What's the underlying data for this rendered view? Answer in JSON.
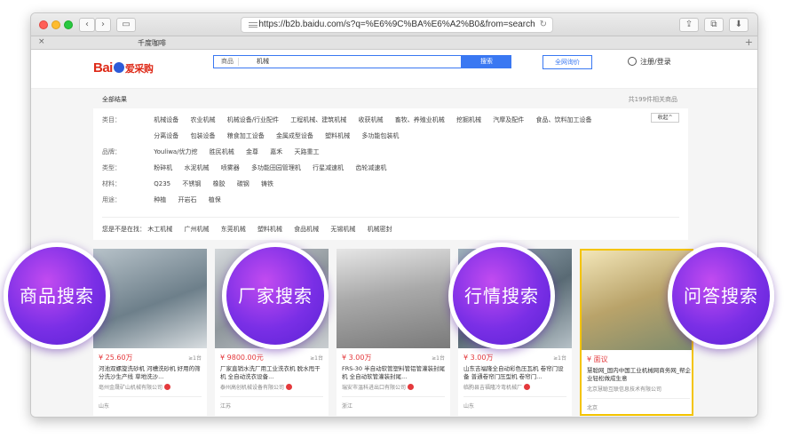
{
  "browser": {
    "url": "https://b2b.baidu.com/s?q=%E6%9C%BA%E6%A2%B0&from=search",
    "tab_title": "千度咖啡",
    "back_label": "‹",
    "forward_label": "›",
    "new_tab_label": "+",
    "close_tab_label": "×"
  },
  "header": {
    "logo_text": "Bai",
    "logo_sub": "爱采购",
    "search_category": "商品",
    "search_value": "机械",
    "search_button": "搜索",
    "compare_button": "全网询价",
    "user_link": "注册/登录"
  },
  "results": {
    "all_label": "全部结果",
    "count_text": "共199件相关商品"
  },
  "filters": {
    "collapse_label": "收起^",
    "rows": [
      {
        "label": "类目：",
        "options": [
          "机械设备",
          "农业机械",
          "机械设备/行业配件",
          "工程机械、建筑机械",
          "收获机械",
          "畜牧、养殖业机械",
          "挖掘机械",
          "汽摩及配件",
          "食品、饮料加工设备"
        ]
      },
      {
        "label": "",
        "options": [
          "分离设备",
          "包装设备",
          "粮食加工设备",
          "金属成型设备",
          "塑料机械",
          "多功能包装机"
        ]
      },
      {
        "label": "品牌：",
        "options": [
          "Youliwa/优力挖",
          "胜民机械",
          "金尊",
          "嘉禾",
          "天路重工"
        ]
      },
      {
        "label": "类型：",
        "options": [
          "粉碎机",
          "水泥机械",
          "喷雾器",
          "多功能田园管理机",
          "行星减速机",
          "齿轮减速机"
        ]
      },
      {
        "label": "材料：",
        "options": [
          "Q235",
          "不锈钢",
          "橡胶",
          "碳钢",
          "铸铁"
        ]
      },
      {
        "label": "用途：",
        "options": [
          "种植",
          "开岩石",
          "植保"
        ]
      }
    ],
    "suggest_label": "您是不是在找：",
    "suggestions": [
      "木工机械",
      "广州机械",
      "东莞机械",
      "塑料机械",
      "食品机械",
      "无锡机械",
      "机械密封"
    ]
  },
  "products": [
    {
      "price": "¥ 25.60万",
      "moq": "≥1台",
      "title": "河池双螺旋洗砂机 河槽洗砂机 好用的筛分洗沙生产线 草地洗沙...",
      "company": "亳州金晟矿山机械有限公司",
      "region": "山东"
    },
    {
      "price": "¥ 9800.00元",
      "moq": "≥1台",
      "title": "厂家直销水洗厂用工业洗衣机 脱水甩干机 全自动洗衣设备...",
      "company": "泰州高创机械设备有限公司",
      "region": "江苏"
    },
    {
      "price": "¥ 3.00万",
      "moq": "≥1台",
      "title": "FRS-30 半自动软管塑料管铝管灌装封尾机 全自动软管灌装封尾...",
      "company": "瑞安市温科进出口有限公司",
      "region": "浙江"
    },
    {
      "price": "¥ 3.00万",
      "moq": "≥1台",
      "title": "山东吉福隆全自动彩色压瓦机 卷帘门设备 普通卷帘门压型机 卷帘门...",
      "company": "临朐县吉福隆冷弯机械厂",
      "region": "山东"
    },
    {
      "price": "¥ 面议",
      "moq": "",
      "title": "慧聪网_国内中国工业机械网商务网_帮企业轻松做成生意",
      "company": "北京慧聪互联信息技术有限公司",
      "region": "北京"
    }
  ],
  "feature_bubbles": [
    "商品搜索",
    "厂家搜索",
    "行情搜索",
    "问答搜索"
  ]
}
